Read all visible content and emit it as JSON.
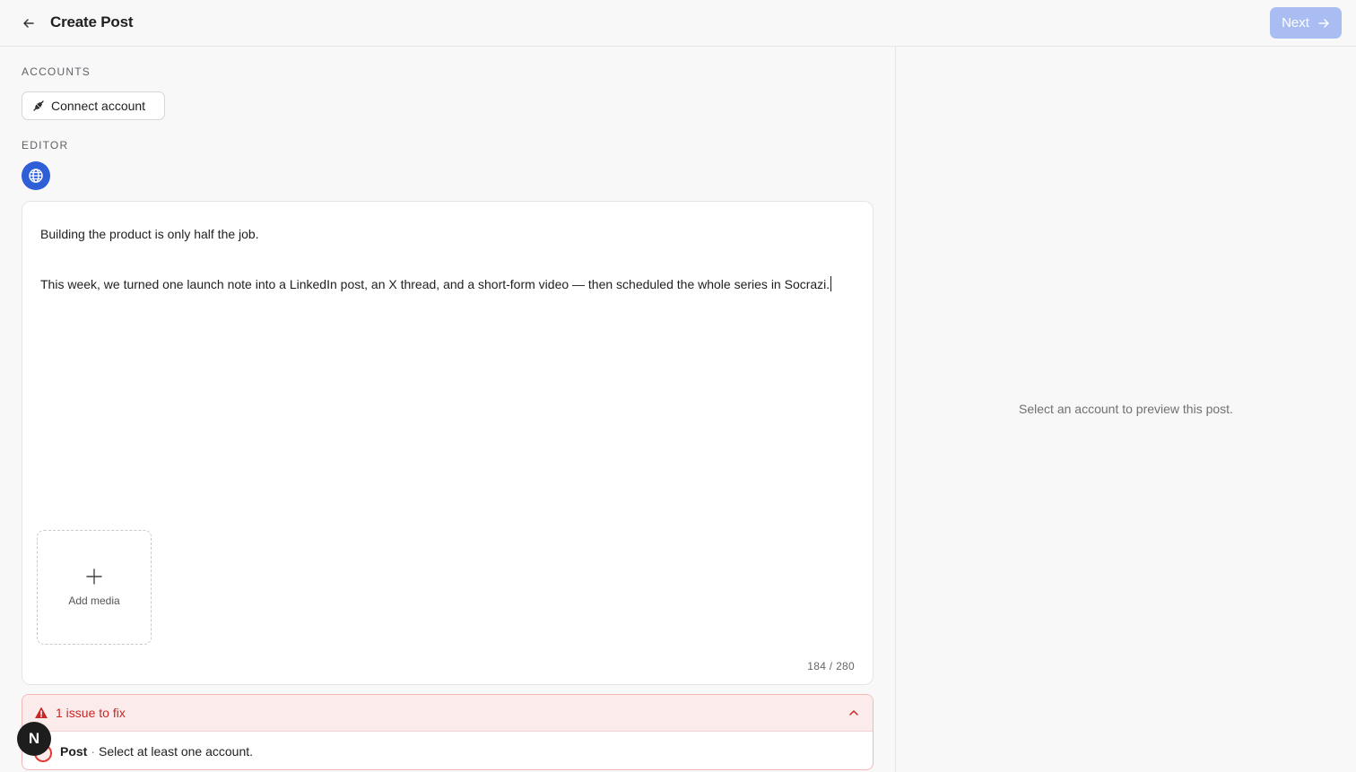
{
  "header": {
    "title": "Create Post",
    "next_label": "Next",
    "back_icon": "arrow-left-icon",
    "next_icon": "arrow-right-icon",
    "next_color": "#a9bdf3"
  },
  "accounts": {
    "section_label": "ACCOUNTS",
    "connect_label": "Connect account",
    "connect_icon": "plug-icon"
  },
  "editor": {
    "section_label": "EDITOR",
    "mode_icon": "globe-icon",
    "mode_color": "#2f5fd6",
    "paragraphs": [
      "Building the product is only half the job.",
      "This week, we turned one launch note into a LinkedIn post, an X thread, and a short-form video — then scheduled the whole series in Socrazi."
    ],
    "add_media_label": "Add media",
    "char_count": "184 / 280"
  },
  "issues": {
    "title": "1 issue to fix",
    "icon": "warning-triangle-icon",
    "accent_color": "#c62828",
    "items": [
      {
        "scope": "Post",
        "separator": "·",
        "message": "Select at least one account."
      }
    ]
  },
  "preview": {
    "hint": "Select an account to preview this post."
  },
  "user": {
    "avatar_initial": "N"
  }
}
